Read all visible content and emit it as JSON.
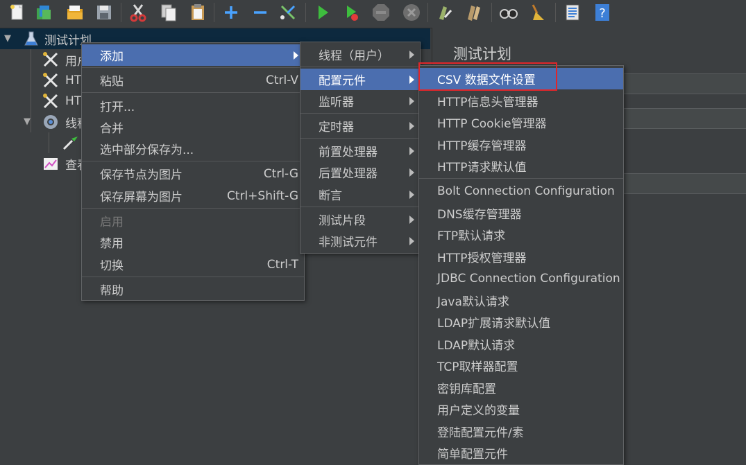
{
  "toolbar": {
    "buttons": [
      {
        "name": "new-icon",
        "color": "#e8e8e8"
      },
      {
        "name": "templates-icon",
        "color": "#3fa34d"
      },
      {
        "name": "open-icon",
        "color": "#e0a020"
      },
      {
        "name": "save-icon",
        "color": "#9aa3ad"
      },
      {
        "name": "cut-icon",
        "color": "#d33a3a"
      },
      {
        "name": "copy-icon",
        "color": "#d9d9d9"
      },
      {
        "name": "paste-icon",
        "color": "#c89a54"
      },
      {
        "name": "expand-icon",
        "color": "#4aa3ff"
      },
      {
        "name": "collapse-icon",
        "color": "#4aa3ff"
      },
      {
        "name": "toggle-icon",
        "color": "#7ac36a"
      },
      {
        "name": "start-icon",
        "color": "#3ebd3e"
      },
      {
        "name": "start-no-pauses-icon",
        "color": "#3ebd3e"
      },
      {
        "name": "stop-icon",
        "color": "#6e6e6e"
      },
      {
        "name": "shutdown-icon",
        "color": "#6e6e6e"
      },
      {
        "name": "clear-icon",
        "color": "#9bb26a"
      },
      {
        "name": "clear-all-icon",
        "color": "#b89a6a"
      },
      {
        "name": "search-icon",
        "color": "#cfcfcf"
      },
      {
        "name": "reset-search-icon",
        "color": "#e0b43a"
      },
      {
        "name": "function-helper-icon",
        "color": "#e6e6e6"
      },
      {
        "name": "help-icon",
        "color": "#3d7fd6"
      }
    ]
  },
  "tree": {
    "root": "测试计划",
    "items": [
      "用户",
      "HTTP",
      "HTTP",
      "线程",
      "",
      "查看"
    ]
  },
  "panel": {
    "title": "测试计划"
  },
  "context_menu": {
    "items": [
      {
        "label": "添加",
        "shortcut": "",
        "submenu": true
      },
      {
        "label": "粘贴",
        "shortcut": "Ctrl-V"
      },
      {
        "label": "打开...",
        "shortcut": ""
      },
      {
        "label": "合并",
        "shortcut": ""
      },
      {
        "label": "选中部分保存为...",
        "shortcut": ""
      },
      {
        "label": "保存节点为图片",
        "shortcut": "Ctrl-G"
      },
      {
        "label": "保存屏幕为图片",
        "shortcut": "Ctrl+Shift-G"
      },
      {
        "label": "启用",
        "shortcut": "",
        "disabled": true
      },
      {
        "label": "禁用",
        "shortcut": ""
      },
      {
        "label": "切换",
        "shortcut": "Ctrl-T"
      },
      {
        "label": "帮助",
        "shortcut": ""
      }
    ]
  },
  "add_submenu": {
    "items": [
      "线程（用户）",
      "配置元件",
      "监听器",
      "定时器",
      "前置处理器",
      "后置处理器",
      "断言",
      "测试片段",
      "非测试元件"
    ]
  },
  "config_submenu": {
    "items": [
      "CSV 数据文件设置",
      "HTTP信息头管理器",
      "HTTP Cookie管理器",
      "HTTP缓存管理器",
      "HTTP请求默认值",
      "Bolt Connection Configuration",
      "DNS缓存管理器",
      "FTP默认请求",
      "HTTP授权管理器",
      "JDBC Connection Configuration",
      "Java默认请求",
      "LDAP扩展请求默认值",
      "LDAP默认请求",
      "TCP取样器配置",
      "密钥库配置",
      "用户定义的变量",
      "登陆配置元件/素",
      "简单配置元件"
    ]
  },
  "colors": {
    "highlight": "#4b6eaf",
    "annotation": "#e0262a",
    "background": "#3c3f41"
  }
}
